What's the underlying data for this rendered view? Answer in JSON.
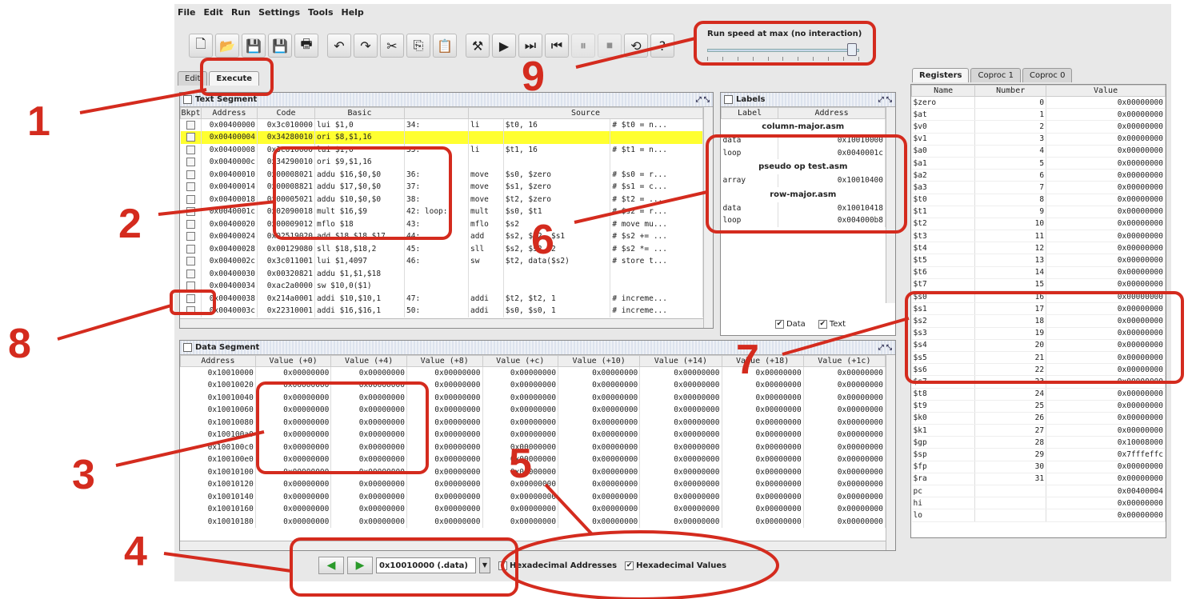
{
  "menu": [
    "File",
    "Edit",
    "Run",
    "Settings",
    "Tools",
    "Help"
  ],
  "toolbar": {
    "icons": [
      "new-file-icon",
      "open-icon",
      "save-icon",
      "save-as-icon",
      "print-icon",
      "undo-icon",
      "redo-icon",
      "cut-icon",
      "copy-icon",
      "paste-icon",
      "assemble-icon",
      "run-icon",
      "step-icon",
      "backstep-icon",
      "pause-icon",
      "stop-icon",
      "reset-icon",
      "help-icon"
    ],
    "glyphs": [
      "🗋",
      "📂",
      "💾",
      "💾",
      "🖶",
      "↶",
      "↷",
      "✂",
      "⎘",
      "📋",
      "⚒",
      "▶",
      "⏭",
      "⏮",
      "⏸",
      "⏹",
      "⟲",
      "?"
    ]
  },
  "speed": {
    "label": "Run speed at max (no interaction)",
    "level": 0.95
  },
  "mainTabs": [
    "Edit",
    "Execute"
  ],
  "text_segment": {
    "title": "Text Segment",
    "columns": [
      "Bkpt",
      "Address",
      "Code",
      "Basic",
      "",
      "Source"
    ],
    "rows": [
      [
        "0x00400000",
        "0x3c010000",
        "lui $1,0",
        "34:",
        "li",
        "$t0, 16",
        "# $t0 = n..."
      ],
      [
        "0x00400004",
        "0x34280010",
        "ori $8,$1,16",
        "",
        "",
        "",
        ""
      ],
      [
        "0x00400008",
        "0x3c010000",
        "lui $1,0",
        "35:",
        "li",
        "$t1, 16",
        "# $t1 = n..."
      ],
      [
        "0x0040000c",
        "0x34290010",
        "ori $9,$1,16",
        "",
        "",
        "",
        ""
      ],
      [
        "0x00400010",
        "0x00008021",
        "addu $16,$0,$0",
        "36:",
        "move",
        "$s0, $zero",
        "# $s0 = r..."
      ],
      [
        "0x00400014",
        "0x00008821",
        "addu $17,$0,$0",
        "37:",
        "move",
        "$s1, $zero",
        "# $s1 = c..."
      ],
      [
        "0x00400018",
        "0x00005021",
        "addu $10,$0,$0",
        "38:",
        "move",
        "$t2, $zero",
        "# $t2 = ..."
      ],
      [
        "0x0040001c",
        "0x02090018",
        "mult $16,$9",
        "42: loop:",
        "mult",
        "$s0, $t1",
        "# $s2 = r..."
      ],
      [
        "0x00400020",
        "0x00009012",
        "mflo $18",
        "43:",
        "mflo",
        "$s2",
        "# move mu..."
      ],
      [
        "0x00400024",
        "0x02519020",
        "add $18,$18,$17",
        "44:",
        "add",
        "$s2, $s2, $s1",
        "# $s2 += ..."
      ],
      [
        "0x00400028",
        "0x00129080",
        "sll $18,$18,2",
        "45:",
        "sll",
        "$s2, $s2, 2",
        "# $s2 *= ..."
      ],
      [
        "0x0040002c",
        "0x3c011001",
        "lui $1,4097",
        "46:",
        "sw",
        "$t2, data($s2)",
        "# store t..."
      ],
      [
        "0x00400030",
        "0x00320821",
        "addu $1,$1,$18",
        "",
        "",
        "",
        ""
      ],
      [
        "0x00400034",
        "0xac2a0000",
        "sw $10,0($1)",
        "",
        "",
        "",
        ""
      ],
      [
        "0x00400038",
        "0x214a0001",
        "addi $10,$10,1",
        "47:",
        "addi",
        "$t2, $t2, 1",
        "# increme..."
      ],
      [
        "0x0040003c",
        "0x22310001",
        "addi $16,$16,1",
        "50:",
        "addi",
        "$s0, $s0, 1",
        "# increme..."
      ]
    ]
  },
  "labels": {
    "title": "Labels",
    "columns": [
      "Label",
      "Address"
    ],
    "sections": [
      {
        "file": "column-major.asm",
        "items": [
          [
            "data",
            "0x10010000"
          ],
          [
            "loop",
            "0x0040001c"
          ]
        ]
      },
      {
        "file": "pseudo op test.asm",
        "items": [
          [
            "array",
            "0x10010400"
          ]
        ]
      },
      {
        "file": "row-major.asm",
        "items": [
          [
            "data",
            "0x10010418"
          ],
          [
            "loop",
            "0x004000b8"
          ]
        ]
      }
    ],
    "data_label": "Data",
    "text_label": "Text"
  },
  "data_segment": {
    "title": "Data Segment",
    "columns": [
      "Address",
      "Value (+0)",
      "Value (+4)",
      "Value (+8)",
      "Value (+c)",
      "Value (+10)",
      "Value (+14)",
      "Value (+18)",
      "Value (+1c)"
    ],
    "addresses": [
      "0x10010000",
      "0x10010020",
      "0x10010040",
      "0x10010060",
      "0x10010080",
      "0x100100a0",
      "0x100100c0",
      "0x100100e0",
      "0x10010100",
      "0x10010120",
      "0x10010140",
      "0x10010160",
      "0x10010180"
    ],
    "value": "0x00000000",
    "nav_value": "0x10010000 (.data)",
    "hex_addr": "Hexadecimal Addresses",
    "hex_val": "Hexadecimal Values"
  },
  "registers": {
    "tabs": [
      "Registers",
      "Coproc 1",
      "Coproc 0"
    ],
    "columns": [
      "Name",
      "Number",
      "Value"
    ],
    "rows": [
      [
        "$zero",
        "0",
        "0x00000000"
      ],
      [
        "$at",
        "1",
        "0x00000000"
      ],
      [
        "$v0",
        "2",
        "0x00000000"
      ],
      [
        "$v1",
        "3",
        "0x00000000"
      ],
      [
        "$a0",
        "4",
        "0x00000000"
      ],
      [
        "$a1",
        "5",
        "0x00000000"
      ],
      [
        "$a2",
        "6",
        "0x00000000"
      ],
      [
        "$a3",
        "7",
        "0x00000000"
      ],
      [
        "$t0",
        "8",
        "0x00000000"
      ],
      [
        "$t1",
        "9",
        "0x00000000"
      ],
      [
        "$t2",
        "10",
        "0x00000000"
      ],
      [
        "$t3",
        "11",
        "0x00000000"
      ],
      [
        "$t4",
        "12",
        "0x00000000"
      ],
      [
        "$t5",
        "13",
        "0x00000000"
      ],
      [
        "$t6",
        "14",
        "0x00000000"
      ],
      [
        "$t7",
        "15",
        "0x00000000"
      ],
      [
        "$s0",
        "16",
        "0x00000000"
      ],
      [
        "$s1",
        "17",
        "0x00000000"
      ],
      [
        "$s2",
        "18",
        "0x00000000"
      ],
      [
        "$s3",
        "19",
        "0x00000000"
      ],
      [
        "$s4",
        "20",
        "0x00000000"
      ],
      [
        "$s5",
        "21",
        "0x00000000"
      ],
      [
        "$s6",
        "22",
        "0x00000000"
      ],
      [
        "$s7",
        "23",
        "0x00000000"
      ],
      [
        "$t8",
        "24",
        "0x00000000"
      ],
      [
        "$t9",
        "25",
        "0x00000000"
      ],
      [
        "$k0",
        "26",
        "0x00000000"
      ],
      [
        "$k1",
        "27",
        "0x00000000"
      ],
      [
        "$gp",
        "28",
        "0x10008000"
      ],
      [
        "$sp",
        "29",
        "0x7fffeffc"
      ],
      [
        "$fp",
        "30",
        "0x00000000"
      ],
      [
        "$ra",
        "31",
        "0x00000000"
      ],
      [
        "pc",
        "",
        "0x00400004"
      ],
      [
        "hi",
        "",
        "0x00000000"
      ],
      [
        "lo",
        "",
        "0x00000000"
      ]
    ]
  },
  "annotations": [
    "1",
    "2",
    "3",
    "4",
    "5",
    "6",
    "7",
    "8",
    "9"
  ],
  "colors": {
    "annotation": "#d42b1e",
    "highlight": "#ffff30"
  }
}
